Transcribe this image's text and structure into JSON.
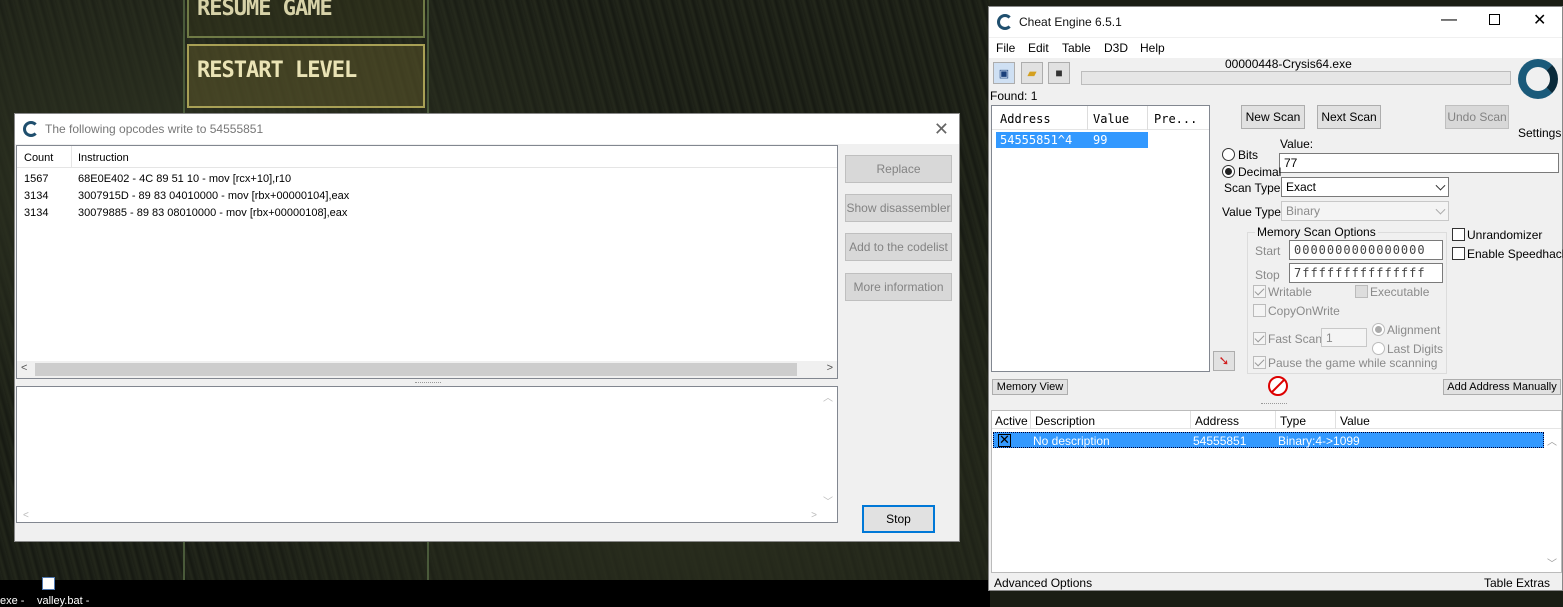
{
  "game": {
    "resume_label": "RESUME GAME",
    "restart_label": "RESTART LEVEL"
  },
  "taskbar": {
    "left_text": "exe -",
    "file_text": "valley.bat -"
  },
  "opcodes_window": {
    "title": "The following opcodes write to 54555851",
    "columns": [
      "Count",
      "Instruction"
    ],
    "rows": [
      {
        "count": "1567",
        "instruction": "68E0E402 - 4C 89 51 10  - mov [rcx+10],r10"
      },
      {
        "count": "3134",
        "instruction": "3007915D - 89 83 04010000  - mov [rbx+00000104],eax"
      },
      {
        "count": "3134",
        "instruction": "30079885 - 89 83 08010000  - mov [rbx+00000108],eax"
      }
    ],
    "buttons": {
      "replace": "Replace",
      "show_disassembler": "Show disassembler",
      "add_codelist": "Add to the codelist",
      "more_info": "More information",
      "stop": "Stop"
    }
  },
  "ce": {
    "title": "Cheat Engine 6.5.1",
    "menu": [
      "File",
      "Edit",
      "Table",
      "D3D",
      "Help"
    ],
    "process": "00000448-Crysis64.exe",
    "found": "Found: 1",
    "settings": "Settings",
    "results_columns": [
      "Address",
      "Value",
      "Pre..."
    ],
    "results": [
      {
        "address": "54555851^4",
        "value": "99"
      }
    ],
    "new_scan": "New Scan",
    "next_scan": "Next Scan",
    "undo_scan": "Undo Scan",
    "value_label": "Value:",
    "value": "77",
    "bits": "Bits",
    "decimal": "Decimal",
    "scan_type_label": "Scan Type",
    "scan_type": "Exact",
    "value_type_label": "Value Type",
    "value_type": "Binary",
    "mem_opts_title": "Memory Scan Options",
    "start_label": "Start",
    "start": "0000000000000000",
    "stop_label": "Stop",
    "stop": "7fffffffffffffff",
    "writable": "Writable",
    "executable": "Executable",
    "copyonwrite": "CopyOnWrite",
    "fast_scan": "Fast Scan",
    "fast_scan_value": "1",
    "alignment": "Alignment",
    "last_digits": "Last Digits",
    "pause_game": "Pause the game while scanning",
    "unrandomizer": "Unrandomizer",
    "speedhack": "Enable Speedhack",
    "memory_view": "Memory View",
    "add_manually": "Add Address Manually",
    "table_columns": [
      "Active",
      "Description",
      "Address",
      "Type",
      "Value"
    ],
    "table_rows": [
      {
        "description": "No description",
        "address": "54555851",
        "type": "Binary:4->1099",
        "value": ""
      }
    ],
    "advanced_options": "Advanced Options",
    "table_extras": "Table Extras"
  }
}
